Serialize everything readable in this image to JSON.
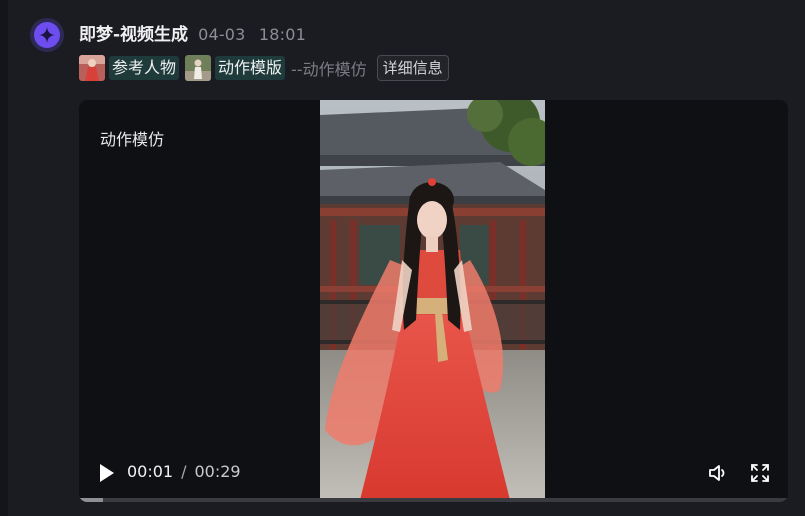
{
  "message": {
    "sender": "即梦-视频生成",
    "date": "04-03",
    "time": "18:01"
  },
  "chips": {
    "reference_person": "参考人物",
    "action_template": "动作模版",
    "suffix": "--动作模仿",
    "detail_button": "详细信息"
  },
  "player": {
    "title": "动作模仿",
    "current_time": "00:01",
    "separator": "/",
    "duration": "00:29",
    "progress_fraction": 0.034
  },
  "icons": {
    "avatar": "star-sparkle-icon",
    "play": "play-icon",
    "volume": "volume-icon",
    "fullscreen": "fullscreen-icon"
  },
  "colors": {
    "background": "#1b1c21",
    "player_background": "#0f1013",
    "accent": "#6e4df0",
    "chip_background": "#1f3a3a"
  }
}
